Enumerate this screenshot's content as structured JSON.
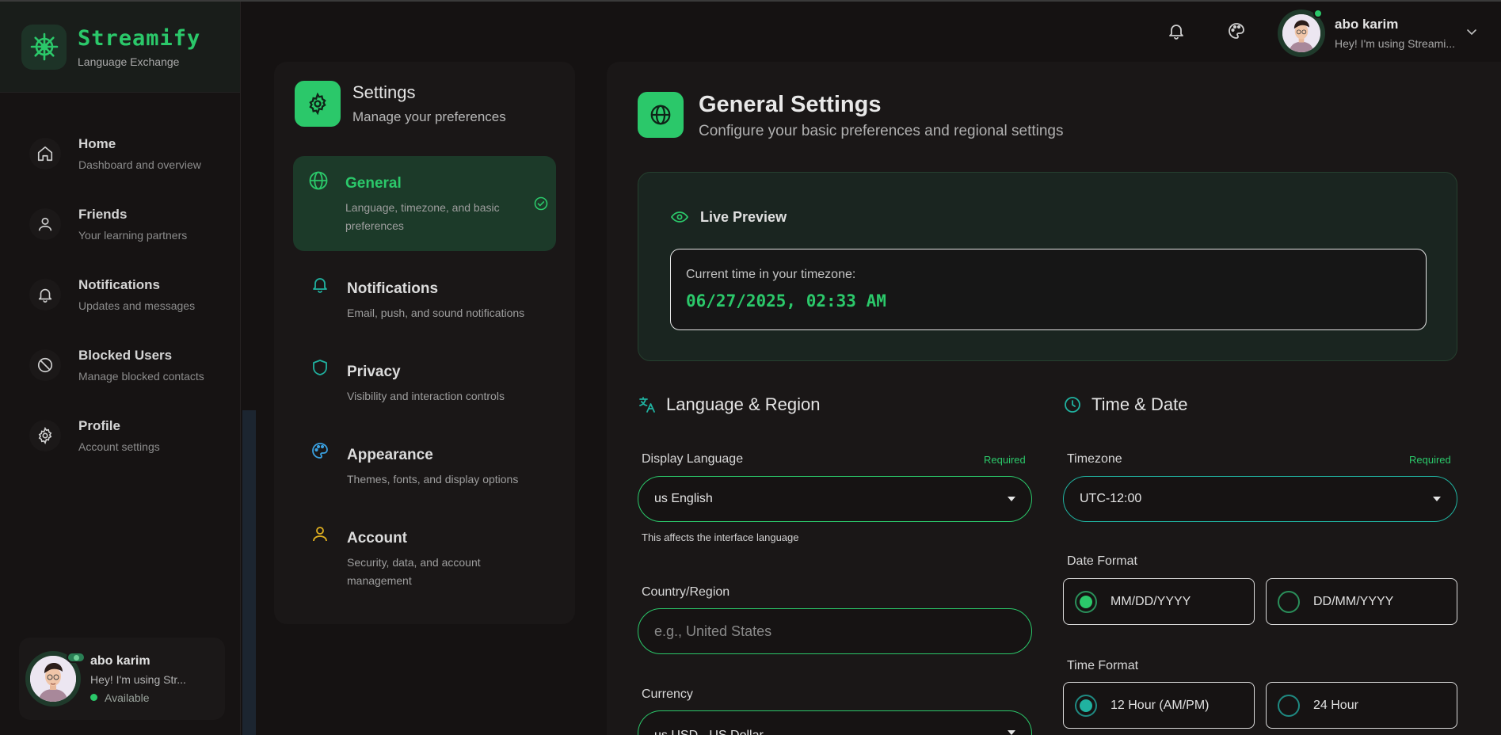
{
  "app": {
    "name": "Streamify",
    "tagline": "Language Exchange"
  },
  "nav": [
    {
      "title": "Home",
      "sub": "Dashboard and overview",
      "icon": "home-icon"
    },
    {
      "title": "Friends",
      "sub": "Your learning partners",
      "icon": "user-icon"
    },
    {
      "title": "Notifications",
      "sub": "Updates and messages",
      "icon": "bell-icon"
    },
    {
      "title": "Blocked Users",
      "sub": "Manage blocked contacts",
      "icon": "block-icon"
    },
    {
      "title": "Profile",
      "sub": "Account settings",
      "icon": "gear-icon"
    }
  ],
  "sidebar_user": {
    "name": "abo karim",
    "status": "Hey! I'm using Str...",
    "availability": "Available"
  },
  "header_user": {
    "name": "abo karim",
    "status": "Hey! I'm using Streami..."
  },
  "settings": {
    "title": "Settings",
    "subtitle": "Manage your preferences",
    "items": [
      {
        "title": "General",
        "desc": "Language, timezone, and basic preferences",
        "icon": "globe-icon",
        "active": true
      },
      {
        "title": "Notifications",
        "desc": "Email, push, and sound notifications",
        "icon": "bell-icon"
      },
      {
        "title": "Privacy",
        "desc": "Visibility and interaction controls",
        "icon": "shield-icon"
      },
      {
        "title": "Appearance",
        "desc": "Themes, fonts, and display options",
        "icon": "palette-icon"
      },
      {
        "title": "Account",
        "desc": "Security, data, and account management",
        "icon": "user-icon"
      }
    ]
  },
  "general": {
    "title": "General Settings",
    "subtitle": "Configure your basic preferences and regional settings",
    "preview": {
      "label": "Live Preview",
      "caption": "Current time in your timezone:",
      "time": "06/27/2025, 02:33 AM"
    },
    "language_region": {
      "heading": "Language & Region",
      "display_language": {
        "label": "Display Language",
        "required": "Required",
        "value": "us English",
        "hint": "This affects the interface language"
      },
      "country": {
        "label": "Country/Region",
        "placeholder": "e.g., United States"
      },
      "currency": {
        "label": "Currency",
        "value": "us USD - US Dollar"
      }
    },
    "time_date": {
      "heading": "Time & Date",
      "timezone": {
        "label": "Timezone",
        "required": "Required",
        "value": "UTC-12:00"
      },
      "date_format": {
        "label": "Date Format",
        "options": [
          "MM/DD/YYYY",
          "DD/MM/YYYY"
        ],
        "selected": "MM/DD/YYYY"
      },
      "time_format": {
        "label": "Time Format",
        "options": [
          "12 Hour (AM/PM)",
          "24 Hour"
        ],
        "selected": "12 Hour (AM/PM)"
      }
    }
  },
  "colors": {
    "accent": "#2bc86a",
    "teal": "#20b2a0",
    "background": "#151212",
    "panel": "#1a1717"
  }
}
